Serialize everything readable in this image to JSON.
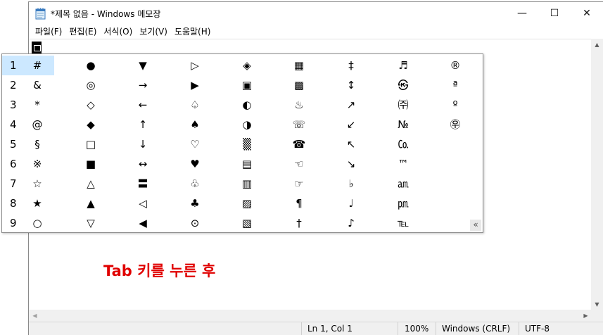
{
  "window": {
    "title": "*제목 없음 - Windows 메모장",
    "minimize_icon": "—",
    "maximize_icon": "☐",
    "close_icon": "✕"
  },
  "menu": [
    "파일(F)",
    "편집(E)",
    "서식(O)",
    "보기(V)",
    "도움말(H)"
  ],
  "status": {
    "position": "Ln 1, Col 1",
    "zoom": "100%",
    "line_ending": "Windows (CRLF)",
    "encoding": "UTF-8"
  },
  "annotation": "Tab 키를 누른 후",
  "ime": {
    "expand_icon": "«",
    "rows": [
      {
        "num": "1",
        "symbols": [
          "#",
          "●",
          "▼",
          "▷",
          "◈",
          "▦",
          "‡",
          "♬",
          "®"
        ]
      },
      {
        "num": "2",
        "symbols": [
          "&",
          "◎",
          "→",
          "▶",
          "▣",
          "▩",
          "↕",
          "㉿",
          "ª"
        ]
      },
      {
        "num": "3",
        "symbols": [
          "*",
          "◇",
          "←",
          "♤",
          "◐",
          "♨",
          "↗",
          "㈜",
          "º"
        ]
      },
      {
        "num": "4",
        "symbols": [
          "@",
          "◆",
          "↑",
          "♠",
          "◑",
          "☏",
          "↙",
          "№",
          "㉾"
        ]
      },
      {
        "num": "5",
        "symbols": [
          "§",
          "□",
          "↓",
          "♡",
          "▒",
          "☎",
          "↖",
          "㏇",
          ""
        ]
      },
      {
        "num": "6",
        "symbols": [
          "※",
          "■",
          "↔",
          "♥",
          "▤",
          "☜",
          "↘",
          "™",
          ""
        ]
      },
      {
        "num": "7",
        "symbols": [
          "☆",
          "△",
          "〓",
          "♧",
          "▥",
          "☞",
          "♭",
          "㏂",
          ""
        ]
      },
      {
        "num": "8",
        "symbols": [
          "★",
          "▲",
          "◁",
          "♣",
          "▨",
          "¶",
          "♩",
          "㏘",
          ""
        ]
      },
      {
        "num": "9",
        "symbols": [
          "○",
          "▽",
          "◀",
          "⊙",
          "▧",
          "†",
          "♪",
          "℡",
          ""
        ]
      }
    ]
  }
}
